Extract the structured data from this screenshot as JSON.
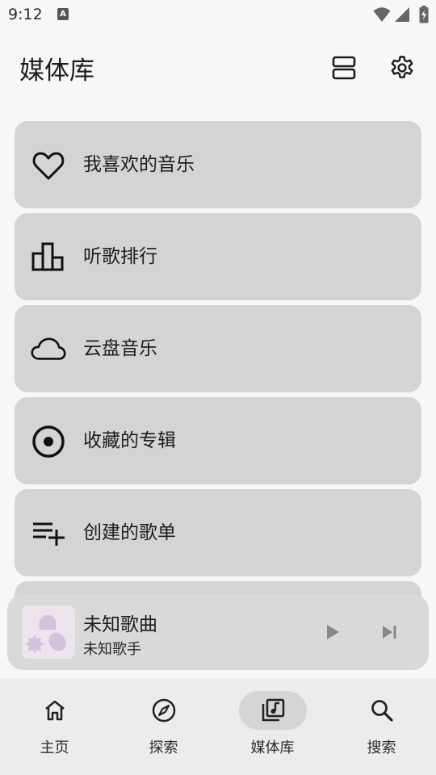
{
  "status_bar": {
    "time": "9:12",
    "notification_badge": "A",
    "icons": [
      "notification-a-icon",
      "wifi-icon",
      "cell-signal-icon",
      "battery-charging-icon"
    ]
  },
  "app_bar": {
    "title": "媒体库",
    "actions": [
      {
        "icon": "view-layout-icon"
      },
      {
        "icon": "settings-gear-icon"
      }
    ]
  },
  "library": {
    "items": [
      {
        "label": "我喜欢的音乐",
        "icon": "heart-outline-icon"
      },
      {
        "label": "听歌排行",
        "icon": "ranking-bars-icon"
      },
      {
        "label": "云盘音乐",
        "icon": "cloud-outline-icon"
      },
      {
        "label": "收藏的专辑",
        "icon": "album-disc-icon"
      },
      {
        "label": "创建的歌单",
        "icon": "playlist-add-icon"
      }
    ]
  },
  "mini_player": {
    "title": "未知歌曲",
    "artist": "未知歌手",
    "cover_icon": "placeholder-shapes-icon",
    "play_icon": "play-icon",
    "next_icon": "skip-next-icon"
  },
  "bottom_nav": {
    "active_index": 2,
    "items": [
      {
        "label": "主页",
        "icon": "home-icon"
      },
      {
        "label": "探索",
        "icon": "compass-icon"
      },
      {
        "label": "媒体库",
        "icon": "library-music-icon"
      },
      {
        "label": "搜索",
        "icon": "search-icon"
      }
    ]
  },
  "colors": {
    "background": "#f7f7f7",
    "card": "#d4d4d4",
    "player": "#d9d9d9",
    "nav_bar": "#ececec",
    "nav_active_pill": "#d5d5d5",
    "cover_bg": "#ece5ef",
    "cover_shape": "#d3c2dc"
  }
}
